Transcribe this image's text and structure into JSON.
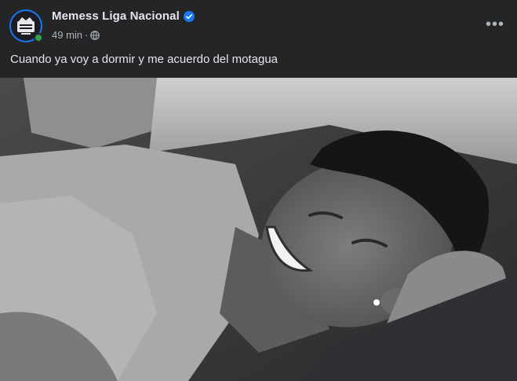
{
  "post": {
    "page_name": "Memess Liga Nacional",
    "verified_icon": "verified-badge-icon",
    "time": "49 min",
    "separator": "·",
    "audience_icon": "globe-icon",
    "more_icon": "more-options-icon",
    "more_label": "•••",
    "caption": "Cuando ya voy a dormir y me acuerdo del motagua"
  },
  "colors": {
    "background": "#242526",
    "primary_text": "#e4e6eb",
    "secondary_text": "#b0b3b8",
    "verified_blue": "#1877f2",
    "online_green": "#31a24c"
  }
}
